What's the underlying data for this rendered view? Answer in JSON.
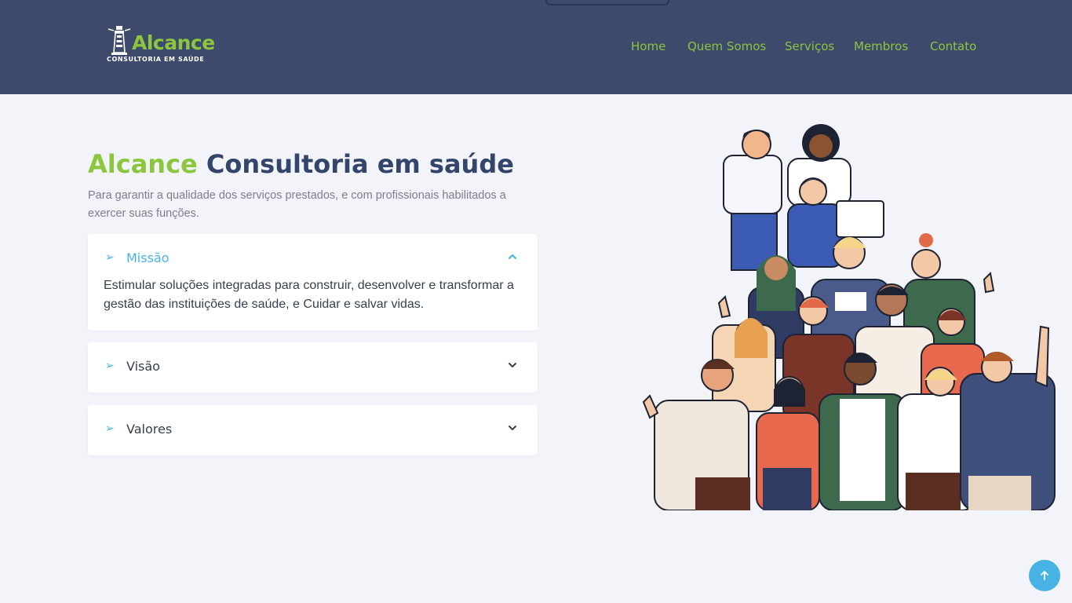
{
  "brand": {
    "name": "Alcance",
    "tagline": "CONSULTORIA EM SAÚDE",
    "icon": "lighthouse-icon",
    "primary_color": "#8cc63f",
    "header_color": "#3d4a6b"
  },
  "nav": {
    "items": [
      {
        "label": "Home"
      },
      {
        "label": "Quem Somos"
      },
      {
        "label": "Serviços"
      },
      {
        "label": "Membros"
      },
      {
        "label": "Contato"
      }
    ]
  },
  "hero": {
    "title_part1": "Alcance",
    "title_part2": "Consultoria em saúde",
    "subtitle": "Para garantir a qualidade dos serviços prestados, e com profissionais habilitados a exercer suas funções."
  },
  "accordion": {
    "accent_color": "#47b2e4",
    "items": [
      {
        "title": "Missão",
        "expanded": true,
        "body": "Estimular soluções integradas para construir, desenvolver e transformar a gestão das instituições de saúde, e Cuidar e salvar vidas.",
        "icon": "arrow-right-icon"
      },
      {
        "title": "Visão",
        "expanded": false,
        "icon": "arrow-right-icon"
      },
      {
        "title": "Valores",
        "expanded": false,
        "icon": "arrow-right-icon"
      }
    ]
  },
  "illustration": {
    "icon": "team-people-illustration"
  },
  "back_to_top": {
    "icon": "arrow-up-icon"
  }
}
